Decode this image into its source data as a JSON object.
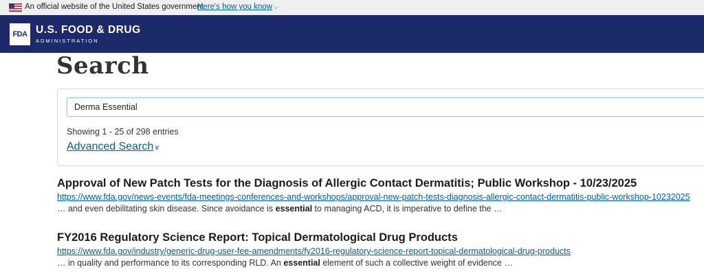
{
  "gov_banner": {
    "text": "An official website of the United States government",
    "link": "Here's how you know"
  },
  "header": {
    "logo": "FDA",
    "brand_main": "U.S. FOOD & DRUG",
    "brand_sub": "ADMINISTRATION",
    "colors": {
      "navy": "#1d2a6a"
    }
  },
  "page": {
    "title": "Search"
  },
  "search": {
    "value": "Derma Essential",
    "showing": "Showing 1 - 25 of 298 entries",
    "advanced_label": "Advanced Search"
  },
  "results": [
    {
      "title": "Approval of New Patch Tests for the Diagnosis of Allergic Contact Dermatitis; Public Workshop - 10/23/2025",
      "url": "https://www.fda.gov/news-events/fda-meetings-conferences-and-workshops/approval-new-patch-tests-diagnosis-allergic-contact-dermatitis-public-workshop-10232025",
      "snippet_before": "… and even debilitating skin disease. Since avoidance is ",
      "snippet_bold": "essential",
      "snippet_after": " to managing ACD, it is imperative to define the …"
    },
    {
      "title": "FY2016 Regulatory Science Report: Topical Dermatological Drug Products",
      "url": "https://www.fda.gov/industry/generic-drug-user-fee-amendments/fy2016-regulatory-science-report-topical-dermatological-drug-products",
      "snippet_before": "… in quality and performance to its corresponding RLD. An ",
      "snippet_bold": "essential",
      "snippet_after": " element of such a collective weight of evidence …"
    }
  ]
}
